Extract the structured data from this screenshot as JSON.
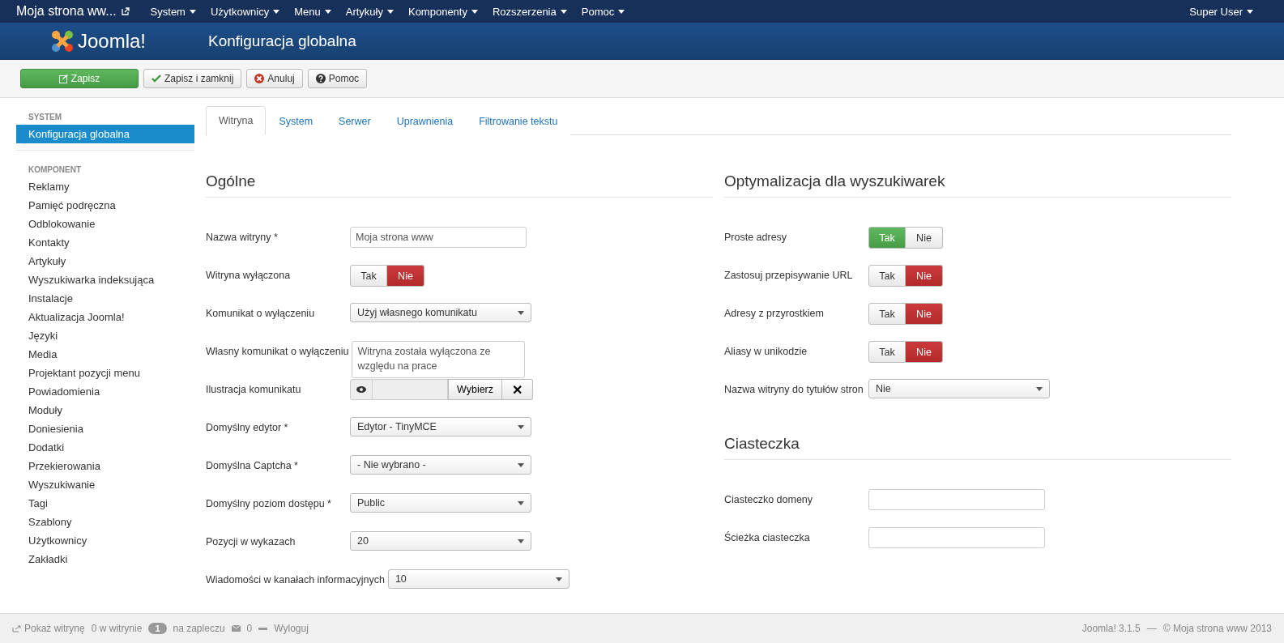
{
  "topbar": {
    "site": "Moja strona ww...",
    "menus": [
      "System",
      "Użytkownicy",
      "Menu",
      "Artykuły",
      "Komponenty",
      "Rozszerzenia",
      "Pomoc"
    ],
    "user": "Super User"
  },
  "header": {
    "logo": "Joomla!",
    "title": "Konfiguracja globalna"
  },
  "toolbar": [
    {
      "kind": "save",
      "label": "Zapisz"
    },
    {
      "kind": "check",
      "label": "Zapisz i zamknij"
    },
    {
      "kind": "cancel",
      "label": "Anuluj"
    },
    {
      "kind": "help",
      "label": "Pomoc"
    }
  ],
  "sidebar": {
    "sections": [
      {
        "heading": "SYSTEM",
        "items": [
          {
            "label": "Konfiguracja globalna",
            "selected": true
          }
        ]
      },
      {
        "heading": "KOMPONENT",
        "items": [
          {
            "label": "Reklamy",
            "selected": false
          },
          {
            "label": "Pamięć podręczna",
            "selected": false
          },
          {
            "label": "Odblokowanie",
            "selected": false
          },
          {
            "label": "Kontakty",
            "selected": false
          },
          {
            "label": "Artykuły",
            "selected": false
          },
          {
            "label": "Wyszukiwarka indeksująca",
            "selected": false
          },
          {
            "label": "Instalacje",
            "selected": false
          },
          {
            "label": "Aktualizacja Joomla!",
            "selected": false
          },
          {
            "label": "Języki",
            "selected": false
          },
          {
            "label": "Media",
            "selected": false
          },
          {
            "label": "Projektant pozycji menu",
            "selected": false
          },
          {
            "label": "Powiadomienia",
            "selected": false
          },
          {
            "label": "Moduły",
            "selected": false
          },
          {
            "label": "Doniesienia",
            "selected": false
          },
          {
            "label": "Dodatki",
            "selected": false
          },
          {
            "label": "Przekierowania",
            "selected": false
          },
          {
            "label": "Wyszukiwanie",
            "selected": false
          },
          {
            "label": "Tagi",
            "selected": false
          },
          {
            "label": "Szablony",
            "selected": false
          },
          {
            "label": "Użytkownicy",
            "selected": false
          },
          {
            "label": "Zakładki",
            "selected": false
          }
        ]
      }
    ]
  },
  "tabs": [
    {
      "label": "Witryna",
      "selected": true
    },
    {
      "label": "System",
      "selected": false
    },
    {
      "label": "Serwer",
      "selected": false
    },
    {
      "label": "Uprawnienia",
      "selected": false
    },
    {
      "label": "Filtrowanie tekstu",
      "selected": false
    }
  ],
  "columns": [
    {
      "sections": [
        {
          "title": "Ogólne",
          "fields": [
            {
              "kind": "text",
              "label": "Nazwa witryny *",
              "value": "Moja strona www"
            },
            {
              "kind": "toggle",
              "label": "Witryna wyłączona",
              "options": [
                {
                  "label": "Tak",
                  "kind": "yes",
                  "selected": false
                },
                {
                  "label": "Nie",
                  "kind": "no",
                  "selected": true
                }
              ]
            },
            {
              "kind": "select",
              "label": "Komunikat o wyłączeniu",
              "value": "Użyj własnego komunikatu"
            },
            {
              "kind": "textarea",
              "label": "Własny komunikat o wyłączeniu",
              "value": "Witryna została wyłączona ze względu na prace"
            },
            {
              "kind": "media",
              "label": "Ilustracja komunikatu",
              "button": "Wybierz",
              "clear": "✕"
            },
            {
              "kind": "select",
              "label": "Domyślny edytor *",
              "value": "Edytor - TinyMCE"
            },
            {
              "kind": "select",
              "label": "Domyślna Captcha *",
              "value": "- Nie wybrano -"
            },
            {
              "kind": "select",
              "label": "Domyślny poziom dostępu *",
              "value": "Public"
            },
            {
              "kind": "select",
              "label": "Pozycji w wykazach",
              "value": "20"
            },
            {
              "kind": "select",
              "label": "Wiadomości w kanałach informacyjnych",
              "value": "10"
            }
          ]
        }
      ]
    },
    {
      "sections": [
        {
          "title": "Optymalizacja dla wyszukiwarek",
          "fields": [
            {
              "kind": "toggle",
              "label": "Proste adresy",
              "options": [
                {
                  "label": "Tak",
                  "kind": "yes",
                  "selected": true
                },
                {
                  "label": "Nie",
                  "kind": "no",
                  "selected": false
                }
              ]
            },
            {
              "kind": "toggle",
              "label": "Zastosuj przepisywanie URL",
              "options": [
                {
                  "label": "Tak",
                  "kind": "yes",
                  "selected": false
                },
                {
                  "label": "Nie",
                  "kind": "no",
                  "selected": true
                }
              ]
            },
            {
              "kind": "toggle",
              "label": "Adresy z przyrostkiem",
              "options": [
                {
                  "label": "Tak",
                  "kind": "yes",
                  "selected": false
                },
                {
                  "label": "Nie",
                  "kind": "no",
                  "selected": true
                }
              ]
            },
            {
              "kind": "toggle",
              "label": "Aliasy w unikodzie",
              "options": [
                {
                  "label": "Tak",
                  "kind": "yes",
                  "selected": false
                },
                {
                  "label": "Nie",
                  "kind": "no",
                  "selected": true
                }
              ]
            },
            {
              "kind": "select",
              "label": "Nazwa witryny do tytułów stron",
              "value": "Nie"
            }
          ]
        },
        {
          "title": "Ciasteczka",
          "fields": [
            {
              "kind": "text",
              "label": "Ciasteczko domeny"
            },
            {
              "kind": "text",
              "label": "Ścieżka ciasteczka"
            }
          ]
        }
      ]
    }
  ],
  "statusbar": {
    "view_site": "Pokaż witrynę",
    "site_users": "0 w witrynie",
    "admin_count": "1",
    "admin_label": "na zapleczu",
    "messages": "0",
    "logout": "Wyloguj",
    "version": "Joomla! 3.1.5",
    "separator": "—",
    "copyright": "© Moja strona www 2013"
  }
}
